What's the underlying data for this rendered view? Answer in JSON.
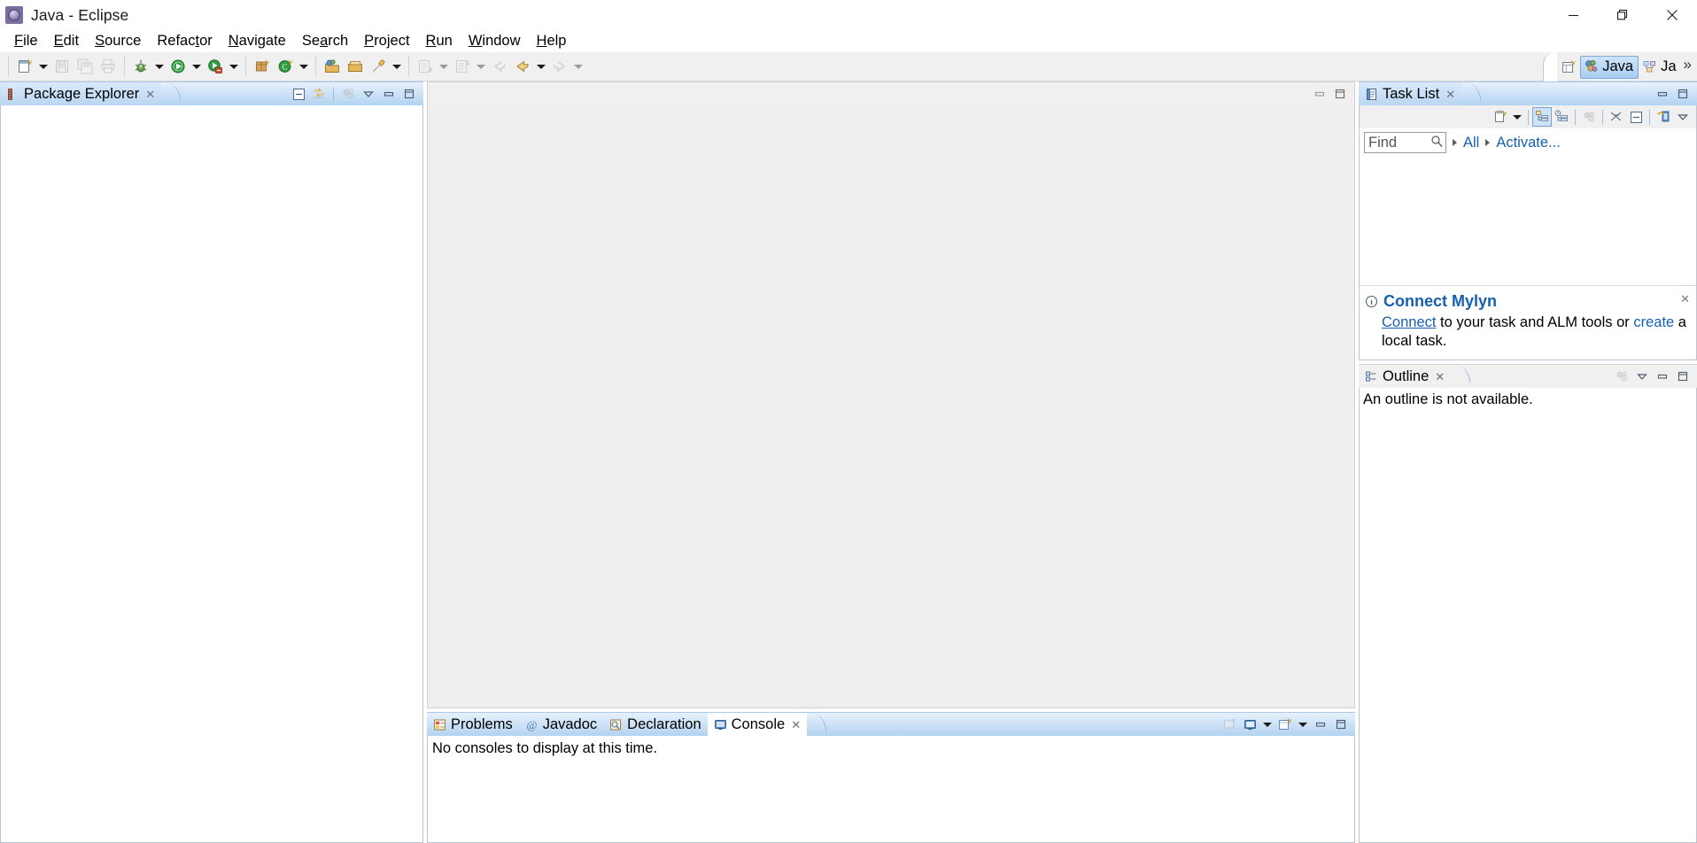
{
  "window": {
    "title": "Java - Eclipse",
    "app_icon": "eclipse-logo-icon",
    "controls": {
      "minimize": "minimize-window-button",
      "restore": "restore-window-button",
      "close": "close-window-button"
    }
  },
  "menubar": {
    "items": [
      {
        "label": "File",
        "mnemonic": "F"
      },
      {
        "label": "Edit",
        "mnemonic": "E"
      },
      {
        "label": "Source",
        "mnemonic": "S"
      },
      {
        "label": "Refactor",
        "mnemonic": "t"
      },
      {
        "label": "Navigate",
        "mnemonic": "N"
      },
      {
        "label": "Search",
        "mnemonic": "a"
      },
      {
        "label": "Project",
        "mnemonic": "P"
      },
      {
        "label": "Run",
        "mnemonic": "R"
      },
      {
        "label": "Window",
        "mnemonic": "W"
      },
      {
        "label": "Help",
        "mnemonic": "H"
      }
    ]
  },
  "toolbar": {
    "groups": [
      {
        "buttons": [
          {
            "name": "new-wizard-icon",
            "enabled": true,
            "dropdown": true
          },
          {
            "name": "save-icon",
            "enabled": false,
            "dropdown": false
          },
          {
            "name": "save-all-icon",
            "enabled": false,
            "dropdown": false
          },
          {
            "name": "print-icon",
            "enabled": false,
            "dropdown": false
          }
        ]
      },
      {
        "buttons": [
          {
            "name": "debug-icon",
            "enabled": true,
            "dropdown": true
          },
          {
            "name": "run-icon",
            "enabled": true,
            "dropdown": true
          },
          {
            "name": "run-external-tools-icon",
            "enabled": true,
            "dropdown": true
          }
        ]
      },
      {
        "buttons": [
          {
            "name": "new-java-package-icon",
            "enabled": true,
            "dropdown": false
          },
          {
            "name": "new-java-class-icon",
            "enabled": true,
            "dropdown": true
          }
        ]
      },
      {
        "buttons": [
          {
            "name": "open-type-icon",
            "enabled": true,
            "dropdown": false
          },
          {
            "name": "open-task-icon",
            "enabled": true,
            "dropdown": false
          },
          {
            "name": "activate-task-icon",
            "enabled": true,
            "dropdown": true
          }
        ]
      },
      {
        "buttons": [
          {
            "name": "next-annotation-icon",
            "enabled": false,
            "dropdown": true
          },
          {
            "name": "previous-annotation-icon",
            "enabled": false,
            "dropdown": true
          }
        ]
      },
      {
        "buttons": [
          {
            "name": "back-history-icon",
            "enabled": false,
            "dropdown": false
          },
          {
            "name": "previous-edit-location-icon",
            "enabled": true,
            "dropdown": true
          },
          {
            "name": "forward-history-icon",
            "enabled": false,
            "dropdown": true
          }
        ]
      }
    ],
    "perspective": {
      "open_perspective_icon": "open-perspective-icon",
      "tabs": [
        {
          "label": "Java",
          "icon": "java-perspective-icon",
          "active": true
        },
        {
          "label": "Ja",
          "icon": "java-browsing-perspective-icon",
          "active": false
        }
      ],
      "overflow": "»"
    }
  },
  "package_explorer": {
    "tab_label": "Package Explorer",
    "tab_icon": "package-explorer-icon",
    "close": "✕",
    "tools": [
      {
        "name": "collapse-all-icon",
        "enabled": true
      },
      {
        "name": "link-with-editor-icon",
        "enabled": true
      },
      {
        "name": "focus-on-active-task-icon",
        "enabled": false
      },
      {
        "name": "view-menu-icon",
        "enabled": true
      },
      {
        "name": "minimize-view-icon",
        "enabled": true
      },
      {
        "name": "maximize-view-icon",
        "enabled": true
      }
    ],
    "tree_items": []
  },
  "editor_area": {
    "tabs": [],
    "content": "",
    "tools": [
      {
        "name": "minimize-editor-icon",
        "enabled": true
      },
      {
        "name": "maximize-editor-icon",
        "enabled": true
      }
    ]
  },
  "bottom_panel": {
    "tabs": [
      {
        "label": "Problems",
        "icon": "problems-icon",
        "active": false
      },
      {
        "label": "Javadoc",
        "icon": "javadoc-icon",
        "active": false
      },
      {
        "label": "Declaration",
        "icon": "declaration-icon",
        "active": false
      },
      {
        "label": "Console",
        "icon": "console-icon",
        "active": true
      }
    ],
    "close": "✕",
    "content": "No consoles to display at this time.",
    "tools": [
      {
        "name": "open-console-icon",
        "enabled": false
      },
      {
        "name": "display-selected-console-icon",
        "enabled": true,
        "dropdown": true
      },
      {
        "name": "new-console-view-icon",
        "enabled": true,
        "dropdown": true
      },
      {
        "name": "minimize-panel-icon",
        "enabled": true
      },
      {
        "name": "maximize-panel-icon",
        "enabled": true
      }
    ]
  },
  "task_list": {
    "tab_label": "Task List",
    "tab_icon": "task-list-icon",
    "close": "✕",
    "header_tools": [
      {
        "name": "minimize-view-icon",
        "enabled": true
      },
      {
        "name": "maximize-view-icon",
        "enabled": true
      }
    ],
    "tools": [
      {
        "name": "new-task-icon",
        "enabled": true,
        "dropdown": true
      },
      {
        "name": "categorized-presentation-icon",
        "enabled": true,
        "selected": true
      },
      {
        "name": "scheduled-presentation-icon",
        "enabled": true,
        "selected": false
      },
      {
        "name": "focus-on-workweek-icon",
        "enabled": false,
        "selected": false
      },
      {
        "name": "collapse-all-tasks-icon",
        "enabled": true,
        "selected": false
      },
      {
        "name": "expand-all-tasks-icon",
        "enabled": true,
        "selected": false
      },
      {
        "name": "synchronize-changed-icon",
        "enabled": true,
        "selected": false
      },
      {
        "name": "view-menu-icon",
        "enabled": true,
        "selected": false
      }
    ],
    "find": {
      "placeholder": "Find",
      "value": "",
      "search_icon": "search-icon"
    },
    "filter_links": [
      {
        "label": "All"
      },
      {
        "label": "Activate..."
      }
    ],
    "items": [],
    "notice": {
      "icon": "info-icon",
      "title": "Connect Mylyn",
      "link_primary": "Connect",
      "body_mid": " to your task and ALM tools or ",
      "link_secondary": "create",
      "body_end": " a local task.",
      "close": "✕"
    }
  },
  "outline": {
    "tab_label": "Outline",
    "tab_icon": "outline-icon",
    "close": "✕",
    "tools": [
      {
        "name": "focus-on-active-task-icon",
        "enabled": false
      },
      {
        "name": "view-menu-icon",
        "enabled": true
      },
      {
        "name": "minimize-view-icon",
        "enabled": true
      },
      {
        "name": "maximize-view-icon",
        "enabled": true
      }
    ],
    "message": "An outline is not available."
  },
  "colors": {
    "active_tab_gradient_start": "#e8f1fb",
    "active_tab_gradient_end": "#b3d3f0",
    "link_blue": "#1560b0",
    "toolbar_bg": "#f0f0f0",
    "editor_bg": "#efefef",
    "border": "#b6c6d6"
  }
}
